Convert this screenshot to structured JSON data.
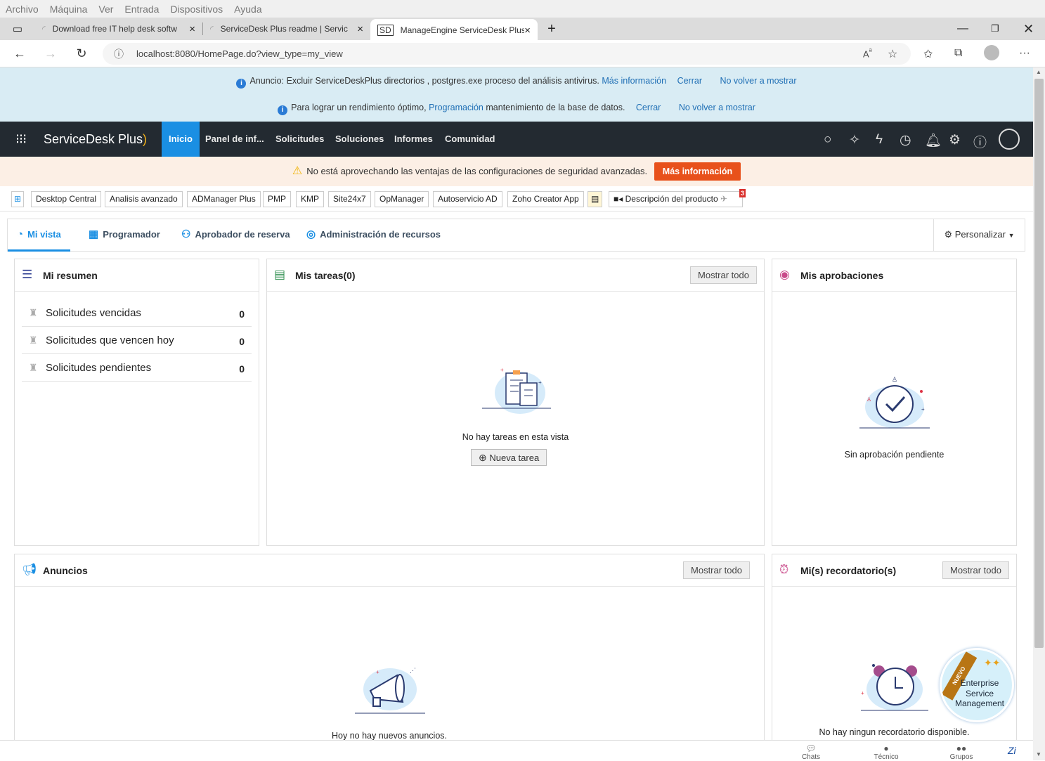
{
  "vm_menu": [
    "Archivo",
    "Máquina",
    "Ver",
    "Entrada",
    "Dispositivos",
    "Ayuda"
  ],
  "browser": {
    "tabs": [
      {
        "title": "Download free IT help desk softw",
        "active": false
      },
      {
        "title": "ServiceDesk Plus readme | Servic",
        "active": false
      },
      {
        "title": "ManageEngine ServiceDesk Plus",
        "active": true
      }
    ],
    "url": "localhost:8080/HomePage.do?view_type=my_view"
  },
  "announcements": {
    "row1_prefix": "Anuncio: Excluir ServiceDeskPlus directorios , postgres.exe proceso del análisis antivirus.",
    "row1_more": "Más información",
    "row1_close": "Cerrar",
    "row1_never": "No volver a mostrar",
    "row2_prefix": "Para lograr un rendimiento óptimo,",
    "row2_link": "Programación",
    "row2_suffix": "mantenimiento de la base de datos.",
    "row2_close": "Cerrar",
    "row2_never": "No volver a mostrar"
  },
  "app": {
    "logo": "ServiceDesk Plus",
    "nav": [
      "Inicio",
      "Panel de inf...",
      "Solicitudes",
      "Soluciones",
      "Informes",
      "Comunidad"
    ]
  },
  "security": {
    "message": "No está aprovechando las ventajas de las configuraciones de seguridad avanzadas.",
    "button": "Más información"
  },
  "quicklinks": [
    "Desktop Central",
    "Analisis avanzado",
    "ADManager Plus",
    "PMP",
    "KMP",
    "Site24x7",
    "OpManager",
    "Autoservicio AD",
    "Zoho Creator App"
  ],
  "product_desc": "Descripción del producto",
  "badge_count": "3",
  "view_tabs": [
    "Mi vista",
    "Programador",
    "Aprobador de reserva",
    "Administración de recursos"
  ],
  "customize": "Personalizar",
  "summary": {
    "title": "Mi resumen",
    "rows": [
      {
        "label": "Solicitudes vencidas",
        "count": "0"
      },
      {
        "label": "Solicitudes que vencen hoy",
        "count": "0"
      },
      {
        "label": "Solicitudes pendientes",
        "count": "0"
      }
    ]
  },
  "tasks": {
    "title": "Mis tareas(0)",
    "show_all": "Mostrar todo",
    "empty": "No hay tareas en esta vista",
    "new_task": "Nueva tarea"
  },
  "approvals": {
    "title": "Mis aprobaciones",
    "empty": "Sin aprobación pendiente"
  },
  "announcements_panel": {
    "title": "Anuncios",
    "show_all": "Mostrar todo",
    "empty": "Hoy no hay nuevos anuncios."
  },
  "reminders": {
    "title": "Mi(s) recordatorio(s)",
    "show_all": "Mostrar todo",
    "empty": "No hay ningun recordatorio disponible."
  },
  "esm": {
    "ribbon": "NUEVO",
    "text": "Enterprise Service Management"
  },
  "bottom": [
    "Chats",
    "Técnico",
    "Grupos"
  ]
}
